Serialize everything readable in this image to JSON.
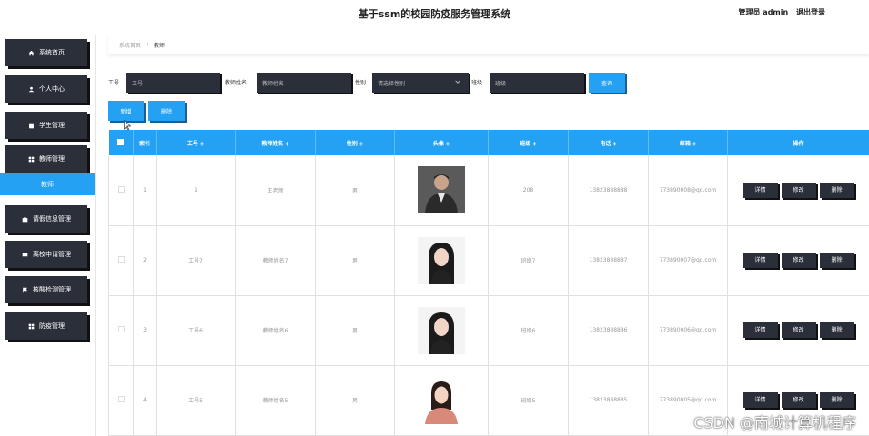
{
  "header": {
    "title": "基于ssm的校园防疫服务管理系统",
    "admin_label": "管理员 admin",
    "logout": "退出登录"
  },
  "sidebar": {
    "items": [
      {
        "label": "系统首页",
        "icon": "home-icon"
      },
      {
        "label": "个人中心",
        "icon": "user-icon"
      },
      {
        "label": "学生管理",
        "icon": "file-icon"
      },
      {
        "label": "教师管理",
        "icon": "grid-icon"
      },
      {
        "label": "请假信息管理",
        "icon": "briefcase-icon"
      },
      {
        "label": "离校申请管理",
        "icon": "card-icon"
      },
      {
        "label": "核酸检测管理",
        "icon": "flag-icon"
      },
      {
        "label": "防疫管理",
        "icon": "grid-icon"
      }
    ],
    "active_sub": "教师"
  },
  "breadcrumb": {
    "home": "系统首页",
    "current": "教师"
  },
  "filters": {
    "gonghao_label": "工号",
    "gonghao_placeholder": "工号",
    "name_label": "教师姓名",
    "name_placeholder": "教师姓名",
    "gender_label": "性别",
    "gender_placeholder": "请选择性别",
    "class_label": "班级",
    "class_placeholder": "班级",
    "search_btn": "查询"
  },
  "actions": {
    "add": "新增",
    "delete": "删除"
  },
  "table": {
    "columns": [
      "索引",
      "工号",
      "教师姓名",
      "性别",
      "头像",
      "班级",
      "电话",
      "邮箱",
      "操作"
    ],
    "rows": [
      {
        "index": "1",
        "id": "1",
        "name": "王老师",
        "gender": "男",
        "class": "208",
        "phone": "13823888888",
        "email": "773890008@qq.com"
      },
      {
        "index": "2",
        "id": "工号7",
        "name": "教师姓名7",
        "gender": "男",
        "class": "班级7",
        "phone": "13823888887",
        "email": "773890007@qq.com"
      },
      {
        "index": "3",
        "id": "工号6",
        "name": "教师姓名6",
        "gender": "男",
        "class": "班级6",
        "phone": "13823888886",
        "email": "773890006@qq.com"
      },
      {
        "index": "4",
        "id": "工号5",
        "name": "教师姓名5",
        "gender": "男",
        "class": "班级5",
        "phone": "13823888885",
        "email": "773890005@qq.com"
      }
    ],
    "row_actions": {
      "detail": "详情",
      "edit": "修改",
      "delete": "删除"
    }
  },
  "sort_glyph": "≑",
  "watermark": "CSDN @南城计算机程序",
  "colors": {
    "accent": "#24a1f2",
    "dark": "#2b2f3a"
  }
}
